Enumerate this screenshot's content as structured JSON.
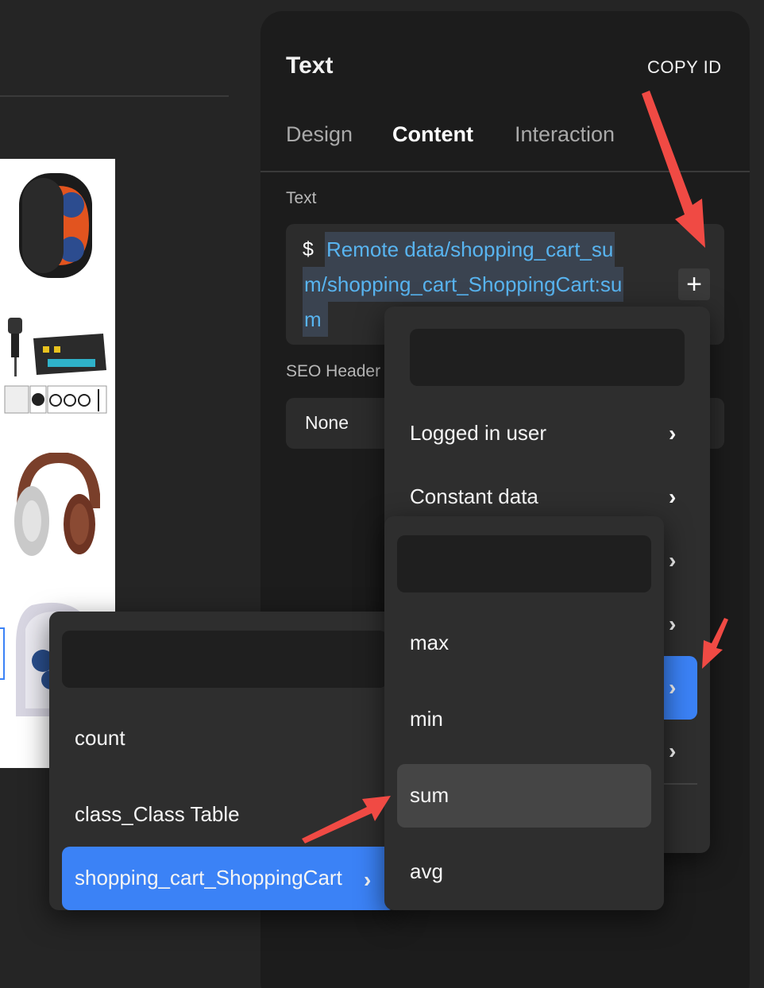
{
  "panel": {
    "title": "Text",
    "copy_id_label": "COPY ID",
    "tabs": [
      "Design",
      "Content",
      "Interaction"
    ],
    "active_tab": "Content",
    "text_field_label": "Text",
    "prefix": "$",
    "binding_lines": [
      "Remote data/shopping_cart_su",
      "m/shopping_cart_ShoppingCart:su",
      "m"
    ],
    "seo_label": "SEO Header",
    "seo_value": "None"
  },
  "menu1": {
    "search_placeholder": "",
    "items": [
      "Logged in user",
      "Constant data"
    ]
  },
  "menu2": {
    "search_placeholder": "",
    "items": [
      "count",
      "class_Class Table",
      "shopping_cart_ShoppingCart"
    ],
    "selected": "shopping_cart_ShoppingCart"
  },
  "menu3": {
    "search_placeholder": "",
    "items": [
      "max",
      "min",
      "sum",
      "avg"
    ],
    "hovered": "sum"
  },
  "colors": {
    "accent": "#3b82f6",
    "binding_text": "#58b4f0",
    "annotation_arrow": "#f04a44"
  }
}
